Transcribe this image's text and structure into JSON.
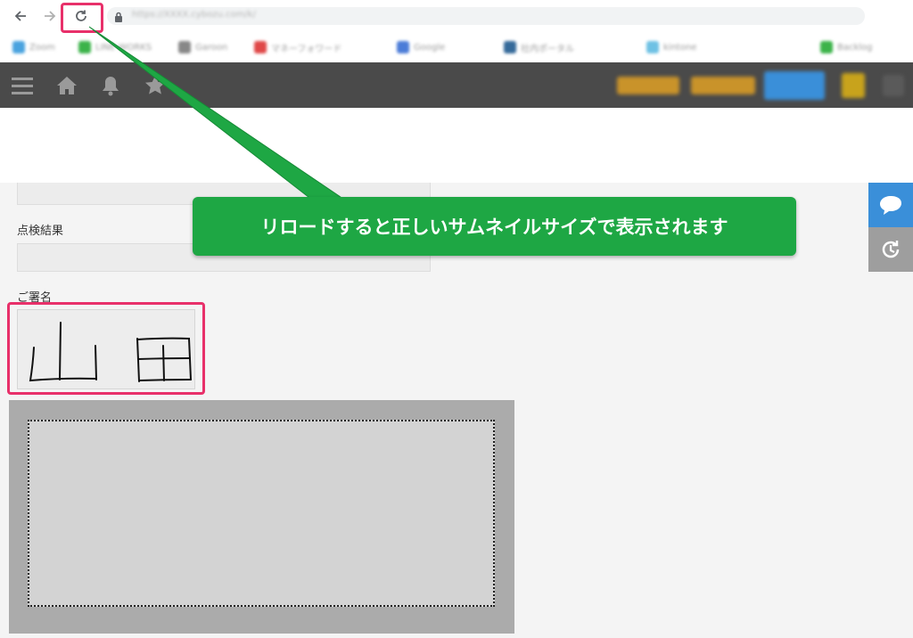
{
  "browser": {
    "url": "https://XXXX.cybozu.com/k/",
    "bookmarks": [
      "Zoom",
      "LINE WORKS",
      "Garoon",
      "マネーフォワード",
      "Google",
      "社内ポータル",
      "kintone",
      "Backlog"
    ]
  },
  "app_header": {
    "icons": [
      "menu-icon",
      "home-icon",
      "bell-icon",
      "star-icon"
    ]
  },
  "form": {
    "inspection_result_label": "点検結果",
    "signature_label": "ご署名",
    "signature_text": "山 田"
  },
  "annotation": {
    "callout_text": "リロードすると正しいサムネイルサイズで表示されます",
    "colors": {
      "highlight": "#e8306a",
      "callout": "#1ea744"
    }
  },
  "side_buttons": [
    "chat-icon",
    "history-icon"
  ]
}
